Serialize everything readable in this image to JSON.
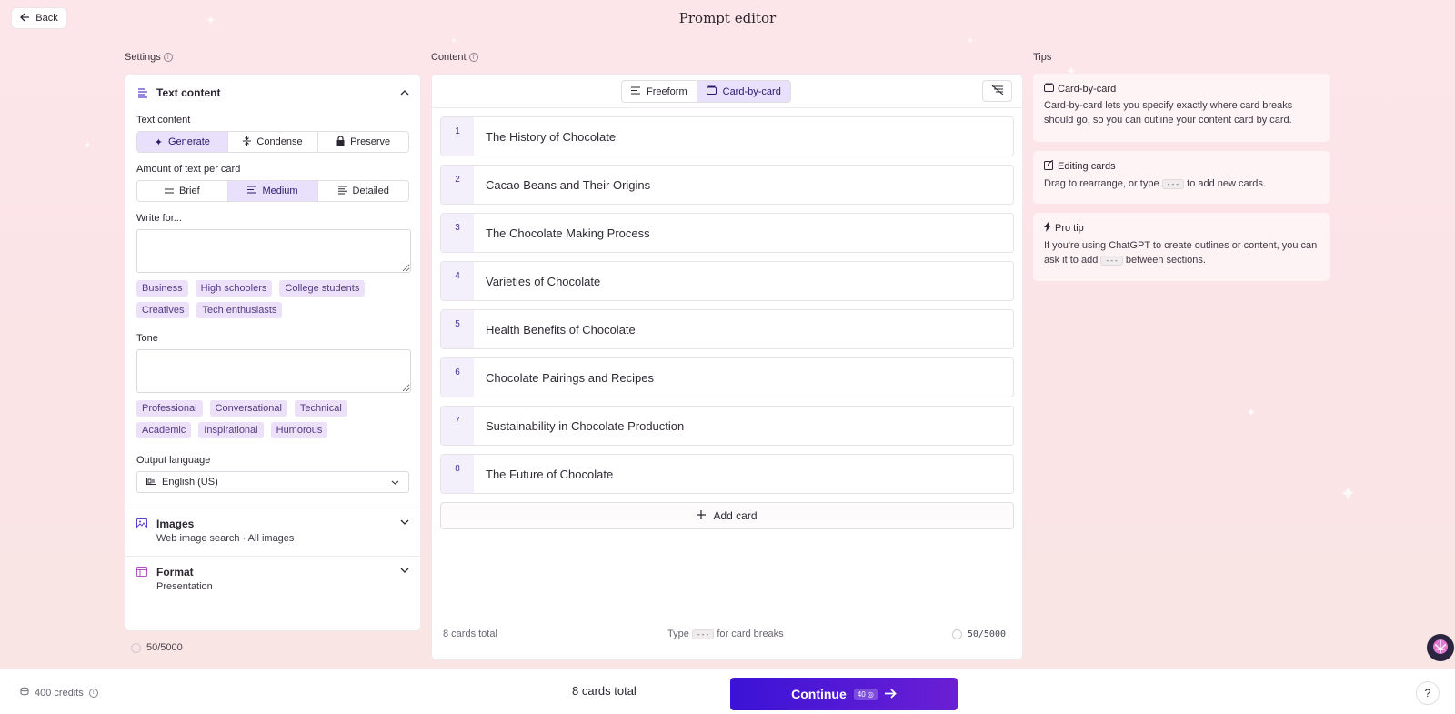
{
  "header": {
    "back_label": "Back",
    "title": "Prompt editor"
  },
  "columns": {
    "settings": "Settings",
    "content": "Content",
    "tips": "Tips"
  },
  "settings": {
    "section_title": "Text content",
    "text_content": {
      "label": "Text content",
      "options": [
        "Generate",
        "Condense",
        "Preserve"
      ],
      "selected": "Generate"
    },
    "amount": {
      "label": "Amount of text per card",
      "options": [
        "Brief",
        "Medium",
        "Detailed"
      ],
      "selected": "Medium"
    },
    "write_for": {
      "label": "Write for...",
      "value": "",
      "chips": [
        "Business",
        "High schoolers",
        "College students",
        "Creatives",
        "Tech enthusiasts"
      ]
    },
    "tone": {
      "label": "Tone",
      "value": "",
      "chips": [
        "Professional",
        "Conversational",
        "Technical",
        "Academic",
        "Inspirational",
        "Humorous"
      ]
    },
    "output_language": {
      "label": "Output language",
      "value": "English (US)"
    },
    "images": {
      "title": "Images",
      "subtitle": "Web image search · All images"
    },
    "format": {
      "title": "Format",
      "subtitle": "Presentation"
    },
    "char_count": "50/5000"
  },
  "content": {
    "modes": [
      "Freeform",
      "Card-by-card"
    ],
    "selected_mode": "Card-by-card",
    "cards": [
      {
        "num": "1",
        "title": "The History of Chocolate"
      },
      {
        "num": "2",
        "title": "Cacao Beans and Their Origins"
      },
      {
        "num": "3",
        "title": "The Chocolate Making Process"
      },
      {
        "num": "4",
        "title": "Varieties of Chocolate"
      },
      {
        "num": "5",
        "title": "Health Benefits of Chocolate"
      },
      {
        "num": "6",
        "title": "Chocolate Pairings and Recipes"
      },
      {
        "num": "7",
        "title": "Sustainability in Chocolate Production"
      },
      {
        "num": "8",
        "title": "The Future of Chocolate"
      }
    ],
    "add_card_label": "Add card",
    "footer": {
      "total": "8 cards total",
      "hint_before": "Type",
      "hint_kbd": "---",
      "hint_after": "for card breaks",
      "char_count": "50/5000"
    }
  },
  "tips": [
    {
      "icon": "card-icon",
      "title": "Card-by-card",
      "body": "Card-by-card lets you specify exactly where card breaks should go, so you can outline your content card by card."
    },
    {
      "icon": "edit-icon",
      "title": "Editing cards",
      "body_before": "Drag to rearrange, or type",
      "kbd": "---",
      "body_after": "to add new cards."
    },
    {
      "icon": "bolt-icon",
      "title": "Pro tip",
      "body_before": "If you're using ChatGPT to create outlines or content, you can ask it to add",
      "kbd": "---",
      "body_after": "between sections."
    }
  ],
  "bottom": {
    "credits": "400 credits",
    "total": "8 cards total",
    "continue_label": "Continue",
    "continue_cost": "40",
    "help": "?"
  },
  "colors": {
    "accent": "#3b13d6",
    "accent_end": "#6b1fd3",
    "selected_bg": "#e9e1fb",
    "chip_bg": "#ece1f8"
  }
}
